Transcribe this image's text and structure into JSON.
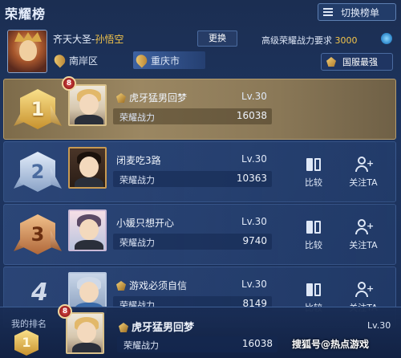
{
  "header": {
    "title": "荣耀榜",
    "switch_label": "切换榜单"
  },
  "hero": {
    "name_prefix": "齐天大圣-",
    "name_highlight": "孙悟空",
    "change_label": "更换",
    "req_label": "高级荣耀战力要求",
    "req_value": "3000",
    "tabs": [
      "南岸区",
      "重庆市"
    ],
    "server_label": "国服最强"
  },
  "ranks": [
    {
      "rank": "1",
      "level_badge": "8",
      "name": "虎牙猛男回梦",
      "lv": "Lv.30",
      "power_label": "荣耀战力",
      "power": "16038"
    },
    {
      "rank": "2",
      "name": "闭麦吃3路",
      "lv": "Lv.30",
      "power_label": "荣耀战力",
      "power": "10363",
      "compare": "比较",
      "follow": "关注TA"
    },
    {
      "rank": "3",
      "name": "小媛只想开心",
      "lv": "Lv.30",
      "power_label": "荣耀战力",
      "power": "9740",
      "compare": "比较",
      "follow": "关注TA"
    },
    {
      "rank": "4",
      "name": "游戏必须自信",
      "lv": "Lv.30",
      "power_label": "荣耀战力",
      "power": "8149",
      "compare": "比较",
      "follow": "关注TA"
    }
  ],
  "my_rank": {
    "label": "我的排名",
    "rank": "1",
    "level_badge": "8",
    "name": "虎牙猛男回梦",
    "lv": "Lv.30",
    "power_label": "荣耀战力",
    "power": "16038"
  },
  "watermark": "搜狐号@热点游戏",
  "colors": {
    "accent_gold": "#f4c54a",
    "bg": "#1e3560"
  }
}
